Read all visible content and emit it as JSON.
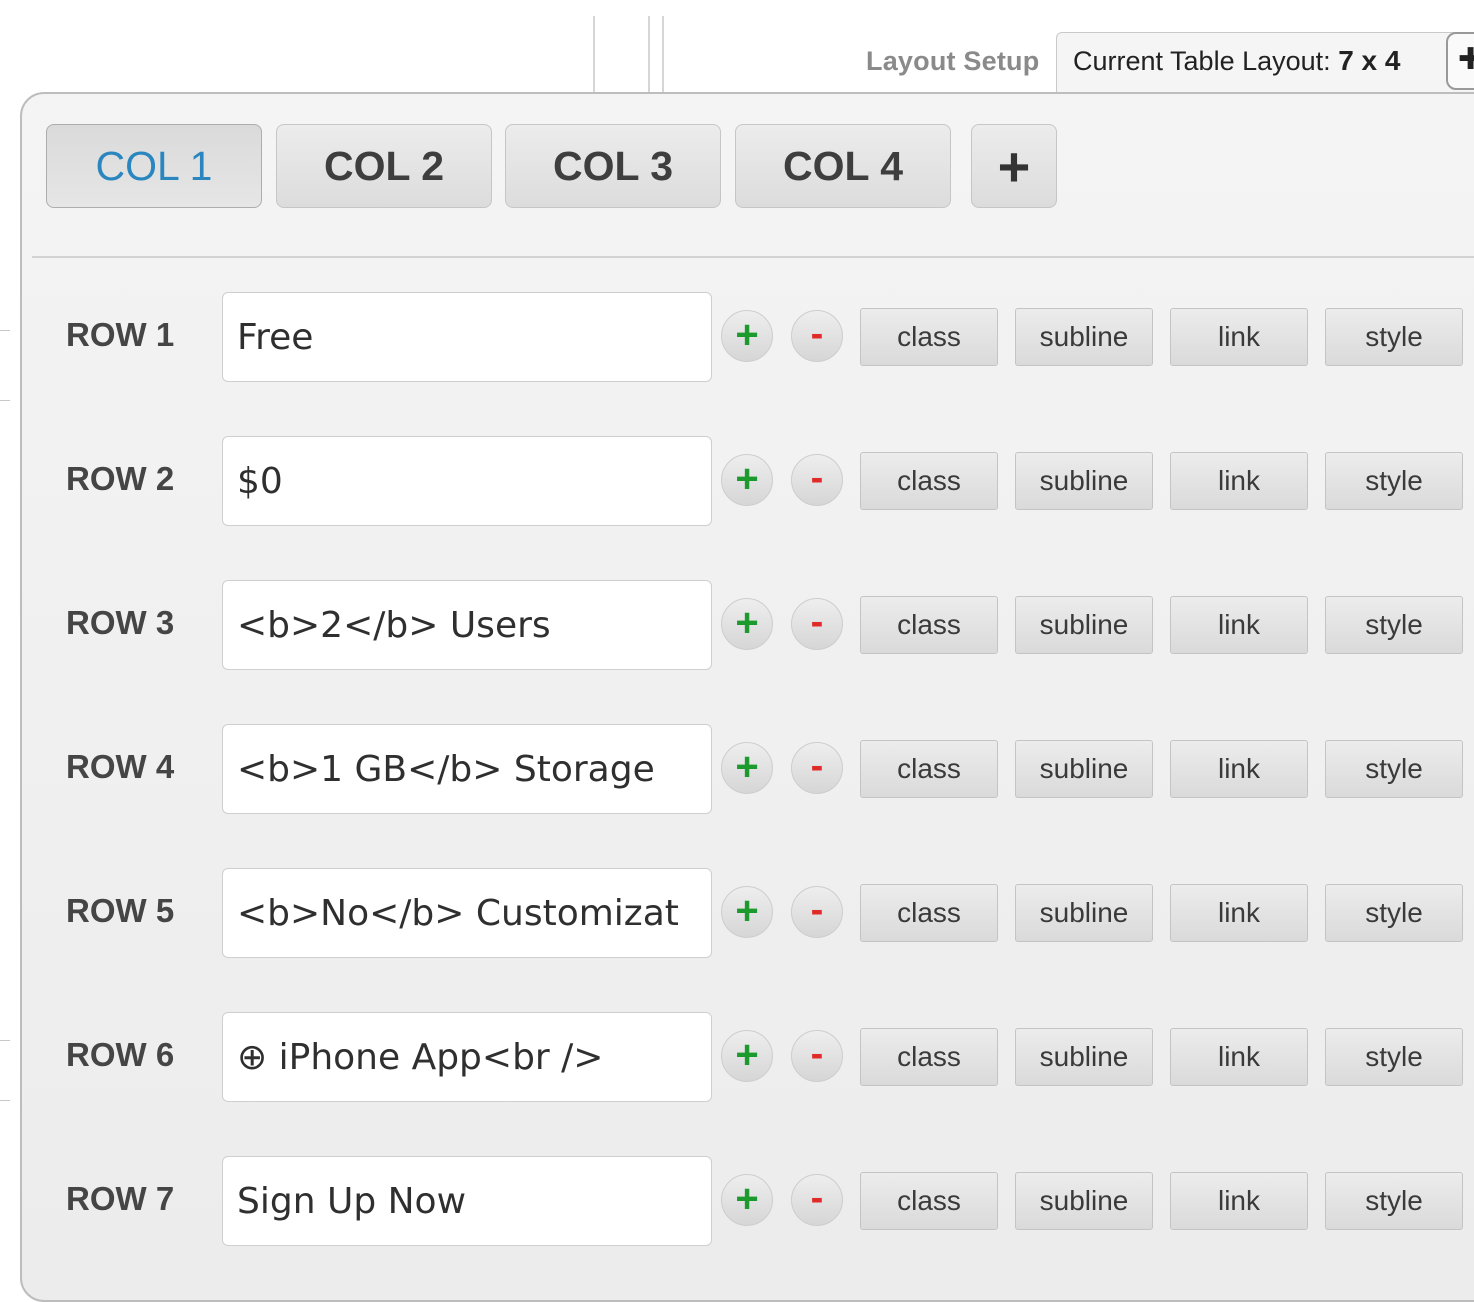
{
  "header": {
    "layout_setup_label": "Layout Setup",
    "current_layout_prefix": "Current Table Layout:",
    "current_layout_value": "7 x 4",
    "gear_glyph": "✚"
  },
  "columns": {
    "tabs": [
      "COL 1",
      "COL 2",
      "COL 3",
      "COL 4"
    ],
    "active_index": 0,
    "add_label": "+"
  },
  "rows": [
    {
      "label": "ROW 1",
      "value": "Free"
    },
    {
      "label": "ROW 2",
      "value": "$0"
    },
    {
      "label": "ROW 3",
      "value": "<b>2</b> Users"
    },
    {
      "label": "ROW 4",
      "value": "<b>1 GB</b> Storage"
    },
    {
      "label": "ROW 5",
      "value": "<b>No</b> Customizat"
    },
    {
      "label": "ROW 6",
      "value": "⊕ iPhone App<br />"
    },
    {
      "label": "ROW 7",
      "value": "Sign Up Now"
    }
  ],
  "row_buttons": {
    "add": "+",
    "remove": "-",
    "class": "class",
    "subline": "subline",
    "link": "link",
    "style": "style"
  },
  "colors": {
    "active_tab": "#2a86bf",
    "add_green": "#1d9a2e",
    "remove_red": "#e02b2b"
  }
}
